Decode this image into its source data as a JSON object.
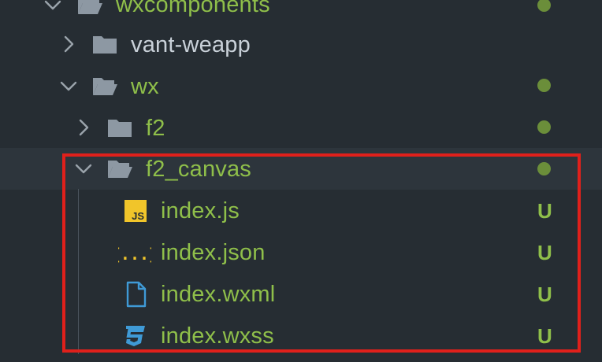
{
  "colors": {
    "background": "#262d33",
    "selected_row": "#2d353c",
    "folder_modified_text": "#8fbf4a",
    "folder_plain_text": "#c9d1d9",
    "folder_icon": "#8d98a3",
    "chevron": "#9aa3ab",
    "modified_dot": "#6b8e3a",
    "untracked_badge": "#8fbf4a",
    "js_icon_bg": "#f1c52a",
    "json_icon": "#f1c52a",
    "xml_icon": "#3f9ad6",
    "css_icon": "#3f9ad6",
    "highlight_border": "#e0201b"
  },
  "tree": {
    "items": [
      {
        "label": "wxcomponents",
        "icon": "folder-open-icon",
        "chevron": "chevron-down-icon",
        "status": "modified-dot"
      },
      {
        "label": "vant-weapp",
        "icon": "folder-closed-icon",
        "chevron": "chevron-right-icon",
        "status": ""
      },
      {
        "label": "wx",
        "icon": "folder-open-icon",
        "chevron": "chevron-down-icon",
        "status": "modified-dot"
      },
      {
        "label": "f2",
        "icon": "folder-closed-icon",
        "chevron": "chevron-right-icon",
        "status": "modified-dot"
      },
      {
        "label": "f2_canvas",
        "icon": "folder-open-icon",
        "chevron": "chevron-down-icon",
        "status": "modified-dot"
      },
      {
        "label": "index.js",
        "icon": "js-file-icon",
        "status": "U",
        "js_icon_text": "JS"
      },
      {
        "label": "index.json",
        "icon": "json-file-icon",
        "status": "U",
        "json_icon_text": "{...}"
      },
      {
        "label": "index.wxml",
        "icon": "document-file-icon",
        "status": "U"
      },
      {
        "label": "index.wxss",
        "icon": "css3-file-icon",
        "status": "U"
      }
    ]
  }
}
